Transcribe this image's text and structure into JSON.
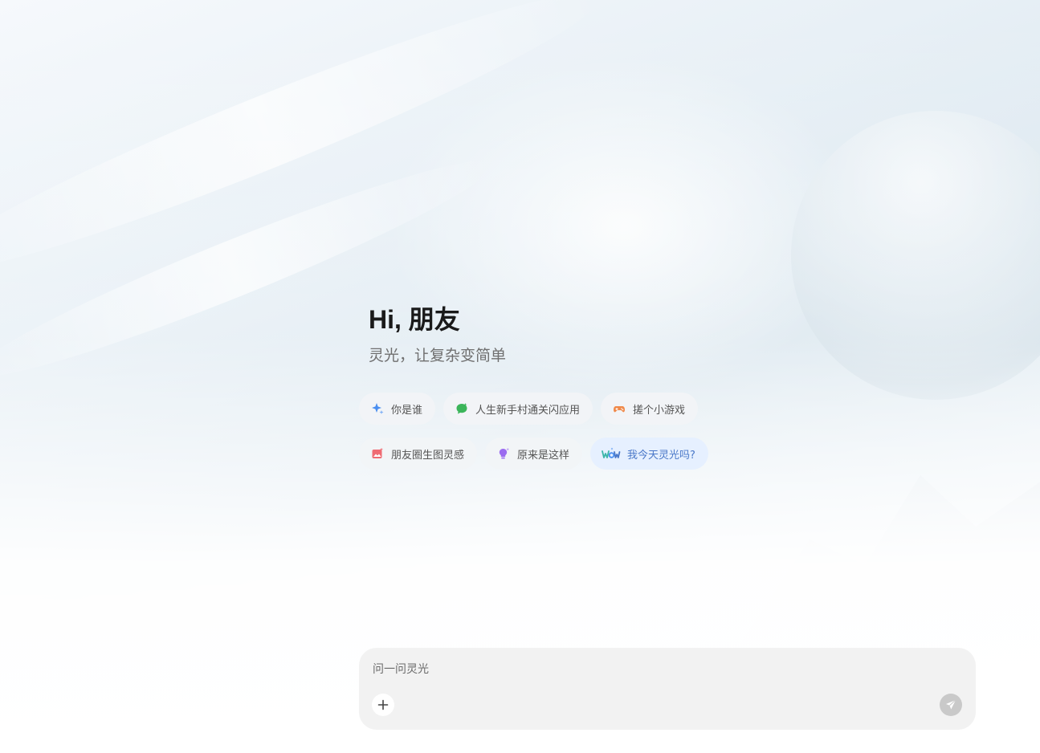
{
  "hero": {
    "greeting": "Hi, 朋友",
    "subtitle": "灵光，让复杂变简单"
  },
  "suggestions": {
    "row1": [
      {
        "label": "你是谁",
        "icon": "sparkle-icon",
        "color": "#4a8ef0"
      },
      {
        "label": "人生新手村通关闪应用",
        "icon": "chat-bubble-icon",
        "color": "#3bb55a"
      },
      {
        "label": "搓个小游戏",
        "icon": "game-controller-icon",
        "color": "#f08a4b"
      }
    ],
    "row2": [
      {
        "label": "朋友圈生图灵感",
        "icon": "image-sparkle-icon",
        "color": "#ef6b73"
      },
      {
        "label": "原来是这样",
        "icon": "lightbulb-icon",
        "color": "#9b6cf0"
      },
      {
        "label": "我今天灵光吗?",
        "icon": "wow-icon",
        "color": "#4a78c8"
      }
    ]
  },
  "composer": {
    "placeholder": "问一问灵光"
  }
}
